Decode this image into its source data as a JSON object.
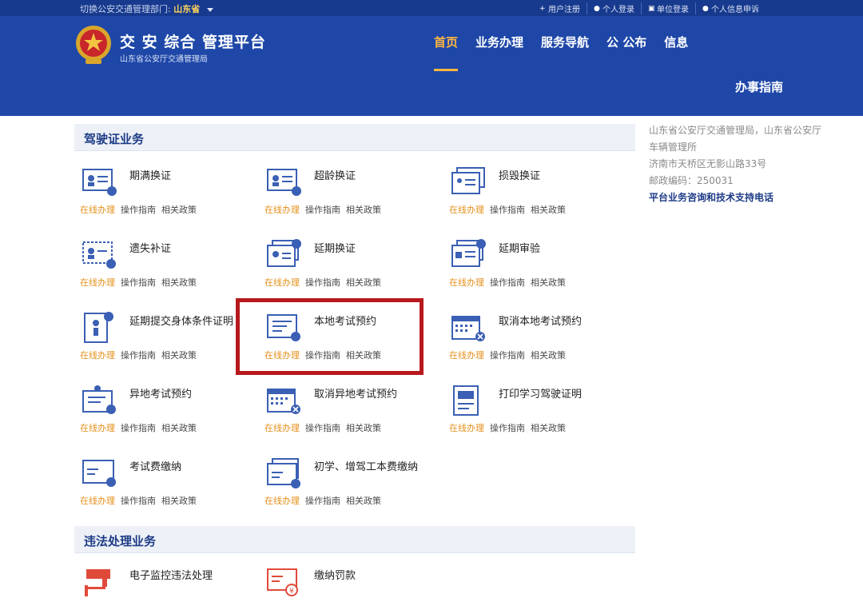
{
  "topbar": {
    "region_label": "切换公安交通管理部门:",
    "region_value": "山东省",
    "links": [
      "用户注册",
      "个人登录",
      "单位登录",
      "个人信息申诉"
    ]
  },
  "header": {
    "title": "交  安  综合    管理平台",
    "subtitle": "山东省公安厅交通管理局",
    "nav": [
      "首页",
      "业务办理",
      "服务导航",
      "公  公布",
      "信息"
    ],
    "guide": "办事指南"
  },
  "sections": {
    "license": "驾驶证业务",
    "violation": "违法处理业务"
  },
  "link_labels": {
    "online": "在线办理",
    "guide": "操作指南",
    "policy": "相关政策"
  },
  "services": [
    "期满换证",
    "超龄换证",
    "损毁换证",
    "遗失补证",
    "延期换证",
    "延期审验",
    "延期提交身体条件证明",
    "本地考试预约",
    "取消本地考试预约",
    "异地考试预约",
    "取消异地考试预约",
    "打印学习驾驶证明",
    "考试费缴纳",
    "初学、增驾工本费缴纳"
  ],
  "violation_services": [
    "电子监控违法处理",
    "缴纳罚款"
  ],
  "right_panel": {
    "org": "山东省公安厅交通管理局，山东省公安厅车辆管理所",
    "address": "济南市天桥区无影山路33号",
    "postcode": "邮政编码：250031",
    "hotline": "平台业务咨询和技术支持电话"
  },
  "colors": {
    "header": "#1e47a8",
    "accent": "#ffb640",
    "online": "#e5901b",
    "highlight": "#b8191d"
  }
}
